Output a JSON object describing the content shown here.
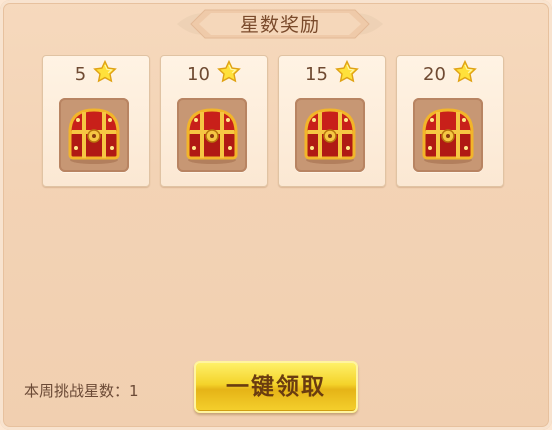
{
  "header": {
    "title": "星数奖励"
  },
  "rewards": [
    {
      "stars": "5"
    },
    {
      "stars": "10"
    },
    {
      "stars": "15"
    },
    {
      "stars": "20"
    }
  ],
  "reward_icon": "treasure-chest-icon",
  "footer": {
    "weekly_stars_label": "本周挑战星数：1",
    "claim_button_label": "一键领取"
  },
  "colors": {
    "panel": "#f3d3b5",
    "button": "#f4d32a",
    "chest_red": "#c8201a",
    "chest_gold": "#f2b52a"
  }
}
